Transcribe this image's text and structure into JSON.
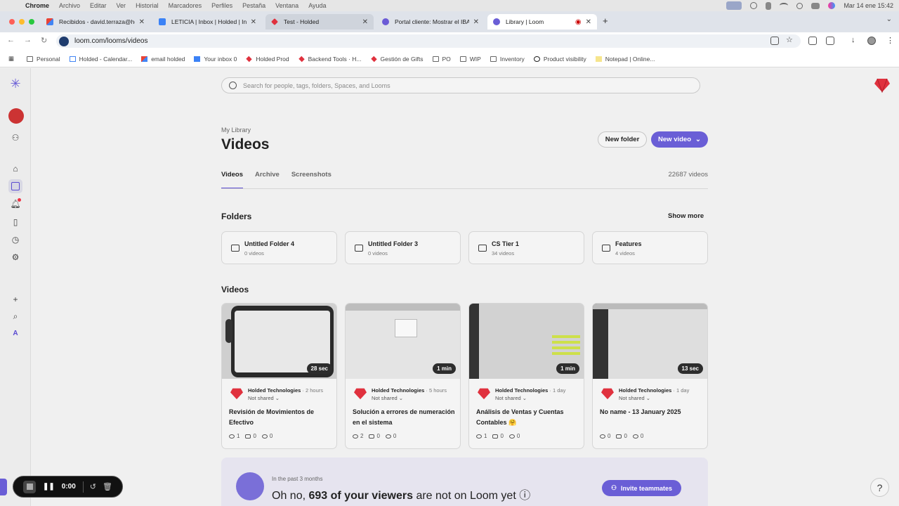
{
  "menubar": {
    "items": [
      "Chrome",
      "Archivo",
      "Editar",
      "Ver",
      "Historial",
      "Marcadores",
      "Perfiles",
      "Pestaña",
      "Ventana",
      "Ayuda"
    ],
    "clock": "Mar 14 ene 15:42"
  },
  "tabs": [
    {
      "title": "Recibidos - david.terraza@ho",
      "favicon": "gmail-icon"
    },
    {
      "title": "LETICIA | Inbox | Holded | Inte",
      "favicon": "intercom-icon"
    },
    {
      "title": "Test - Holded",
      "favicon": "holded-icon"
    },
    {
      "title": "Portal cliente: Mostrar el IBAN",
      "favicon": "clickup-icon"
    },
    {
      "title": "Library | Loom",
      "favicon": "loom-icon"
    }
  ],
  "address": {
    "url": "loom.com/looms/videos"
  },
  "bookmarks": [
    "Personal",
    "Holded - Calendar...",
    "email holded",
    "Your inbox 0",
    "Holded Prod",
    "Backend Tools · H...",
    "Gestión de Gifts",
    "PO",
    "WIP",
    "Inventory",
    "Product visibility",
    "Notepad | Online..."
  ],
  "search": {
    "placeholder": "Search for people, tags, folders, Spaces, and Looms"
  },
  "header": {
    "crumb": "My Library",
    "title": "Videos",
    "new_folder": "New folder",
    "new_video": "New video"
  },
  "library_tabs": [
    "Videos",
    "Archive",
    "Screenshots"
  ],
  "video_count": "22687 videos",
  "folders_section": {
    "title": "Folders",
    "show_more": "Show more"
  },
  "folders": [
    {
      "name": "Untitled Folder 4",
      "count": "0 videos"
    },
    {
      "name": "Untitled Folder 3",
      "count": "0 videos"
    },
    {
      "name": "CS Tier 1",
      "count": "34 videos"
    },
    {
      "name": "Features",
      "count": "4 videos"
    }
  ],
  "videos_section": {
    "title": "Videos"
  },
  "videos": [
    {
      "duration": "28 sec",
      "owner": "Holded Technologies",
      "time": "· 2 hours",
      "share": "Not shared ⌄",
      "title": "Revisión de Movimientos de Efectivo",
      "views": "1",
      "comments": "0",
      "reactions": "0"
    },
    {
      "duration": "1 min",
      "owner": "Holded Technologies",
      "time": "· 5 hours",
      "share": "Not shared ⌄",
      "title": "Solución a errores de numeración en el sistema",
      "views": "2",
      "comments": "0",
      "reactions": "0"
    },
    {
      "duration": "1 min",
      "owner": "Holded Technologies",
      "time": "· 1 day",
      "share": "Not shared ⌄",
      "title": "Análisis de Ventas y Cuentas Contables 🤗",
      "views": "1",
      "comments": "0",
      "reactions": "0"
    },
    {
      "duration": "13 sec",
      "owner": "Holded Technologies",
      "time": "· 1 day",
      "share": "Not shared ⌄",
      "title": "No name - 13 January 2025",
      "views": "0",
      "comments": "0",
      "reactions": "0"
    }
  ],
  "banner": {
    "sub": "In the past 3 months",
    "prefix": "Oh no, ",
    "bold": "693 of your viewers",
    "suffix": " are not on Loom yet ⓘ",
    "invite": "Invite teammates"
  },
  "recorder": {
    "time": "0:00"
  },
  "help": "?",
  "colors": {
    "accent": "#6a5ed6",
    "brand": "#e0313e"
  }
}
